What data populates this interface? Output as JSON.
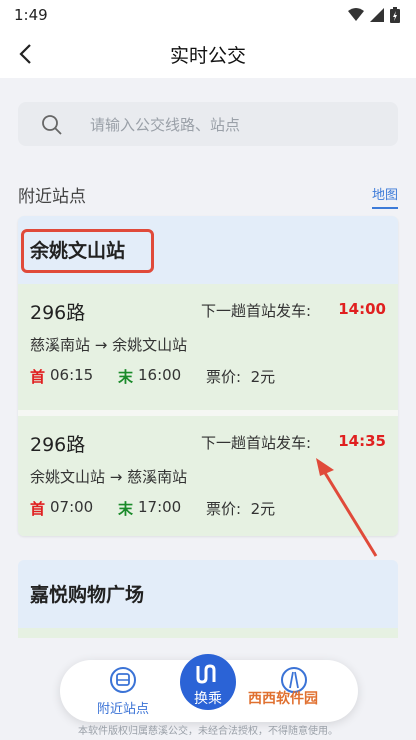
{
  "status": {
    "time": "1:49"
  },
  "header": {
    "title": "实时公交"
  },
  "search": {
    "placeholder": "请输入公交线路、站点"
  },
  "nearby": {
    "title": "附近站点",
    "map_link": "地图"
  },
  "stations": [
    {
      "name": "余姚文山站",
      "routes": [
        {
          "number": "296路",
          "next_label": "下一趟首站发车:",
          "next_time": "14:00",
          "direction": "慈溪南站 → 余姚文山站",
          "first_mark": "首",
          "first_time": "06:15",
          "last_mark": "末",
          "last_time": "16:00",
          "price_label": "票价:",
          "price": "2元"
        },
        {
          "number": "296路",
          "next_label": "下一趟首站发车:",
          "next_time": "14:35",
          "direction": "余姚文山站 → 慈溪南站",
          "first_mark": "首",
          "first_time": "07:00",
          "last_mark": "末",
          "last_time": "17:00",
          "price_label": "票价:",
          "price": "2元"
        }
      ]
    },
    {
      "name": "嘉悦购物广场"
    }
  ],
  "bottom_nav": {
    "nearby_label": "附近站点",
    "transfer_label": "换乘"
  },
  "footer": {
    "text": "本软件版权归属慈溪公交，未经合法授权，不得随意使用。"
  },
  "watermark": {
    "text": "西西软件园"
  },
  "colors": {
    "accent": "#2b63d6",
    "highlight": "#e04a3a",
    "time_red": "#e02020",
    "last_green": "#1a8a2a"
  }
}
